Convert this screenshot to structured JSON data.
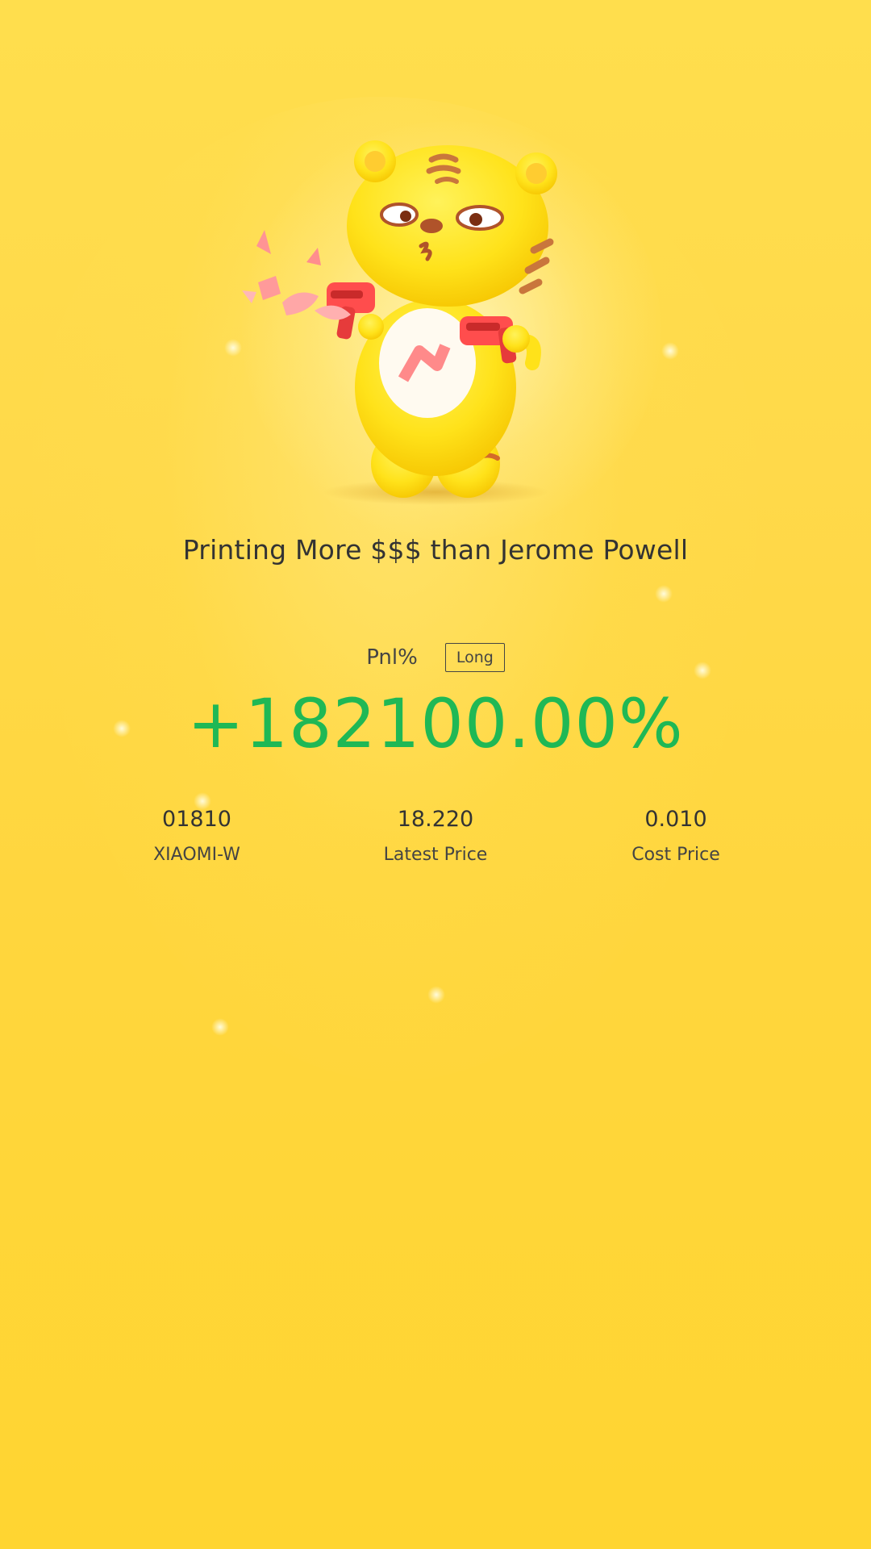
{
  "headline": "Printing More $$$ than Jerome Powell",
  "pnl": {
    "label": "Pnl%",
    "position_type": "Long",
    "value": "+182100.00%",
    "value_color": "#1fb855"
  },
  "stats": [
    {
      "value": "01810",
      "label": "XIAOMI-W"
    },
    {
      "value": "18.220",
      "label": "Latest Price"
    },
    {
      "value": "0.010",
      "label": "Cost Price"
    }
  ],
  "mascot": {
    "icon": "tiger-mascot-money-gun-icon"
  },
  "colors": {
    "background": "#ffd94a",
    "text": "#333333",
    "gain": "#1fb855"
  }
}
